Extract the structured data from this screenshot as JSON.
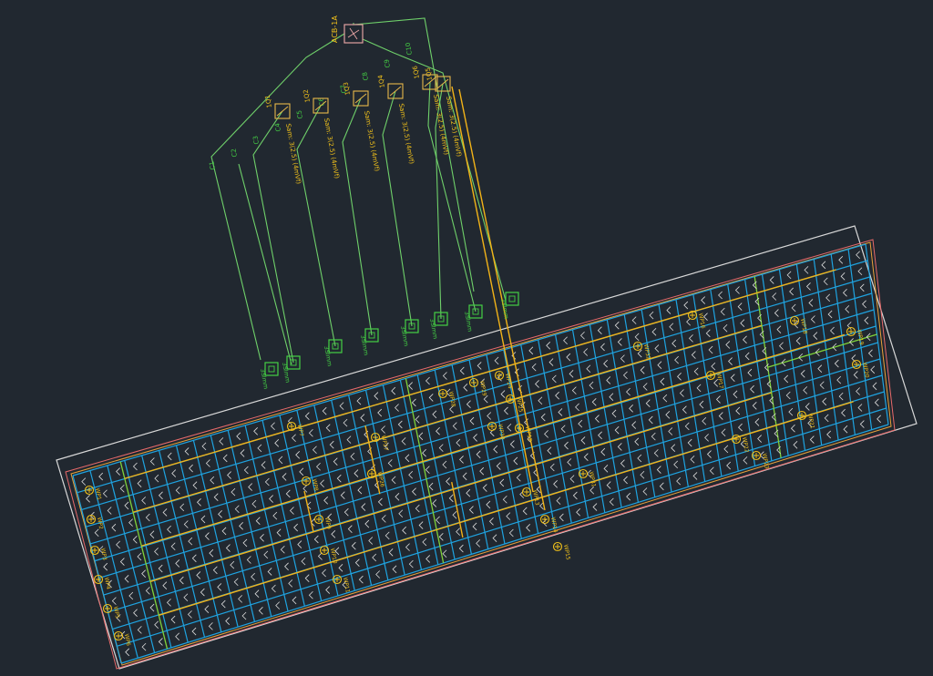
{
  "app": {
    "background": "#212830"
  },
  "colors": {
    "grid": "#1fa3e0",
    "circuit": "#f2b318",
    "wire": "#6fd06a",
    "outline": "#d8d8d8",
    "room_red": "#e86a6a",
    "room_orange": "#e8a23a",
    "text_green": "#44d044",
    "text_yellow": "#f2c21a",
    "board": "#e8b84a"
  },
  "distribution_board": {
    "label": "ACB-1A",
    "icon": "panel-icon"
  },
  "breakers": [
    {
      "id": "1Q1",
      "label": "Sam: 3(2.5) (4mVf)"
    },
    {
      "id": "1Q2",
      "label": "Sam: 3(2.5) (4mVf)"
    },
    {
      "id": "1Q3",
      "label": "Sam: 3(2.5) (4mVf)"
    },
    {
      "id": "1Q4",
      "label": "Sam: 3(2.5) (4mVf)"
    },
    {
      "id": "1Q5",
      "label": "Sam: 3(2.5) (4mVf)"
    },
    {
      "id": "1Q6",
      "label": "Sam: 3(2.5) (4mVf)"
    }
  ],
  "feeders": [
    "C1",
    "C2",
    "C3",
    "C4",
    "C5",
    "C6",
    "C7",
    "C8",
    "C9",
    "C10"
  ],
  "panels": [
    {
      "id": "SP1",
      "label": "3Slmm"
    },
    {
      "id": "SP2",
      "label": "3Slmm"
    },
    {
      "id": "SP3",
      "label": "3Slmm"
    },
    {
      "id": "SP4",
      "label": "3Slmm"
    },
    {
      "id": "SP5",
      "label": "3Slmm"
    },
    {
      "id": "SP6",
      "label": "3Slmm"
    },
    {
      "id": "SP7",
      "label": "3Slmm"
    },
    {
      "id": "SP8",
      "label": "3Slmm"
    }
  ],
  "luminaire_tags": [
    "WP1",
    "WP2",
    "WP3",
    "WP4",
    "WP5",
    "WP6",
    "WP7",
    "WP8",
    "WP9",
    "WP10",
    "WP11",
    "WP12",
    "WP13",
    "WP14",
    "WP15",
    "WP16",
    "WP17",
    "WP18",
    "WP19",
    "WP20",
    "WP21",
    "WP22",
    "WP23",
    "WP24",
    "WP25",
    "WP26",
    "WP27",
    "WP28",
    "WP29",
    "WP30",
    "WP31",
    "WP32"
  ]
}
